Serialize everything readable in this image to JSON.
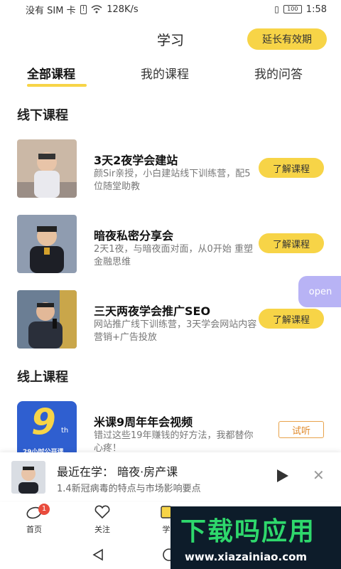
{
  "status_bar": {
    "carrier": "没有 SIM 卡",
    "speed": "128K/s",
    "battery": "100",
    "time": "1:58"
  },
  "header": {
    "title": "学习",
    "extend_button": "延长有效期"
  },
  "tabs": [
    "全部课程",
    "我的课程",
    "我的问答"
  ],
  "sections": {
    "offline": "线下课程",
    "online": "线上课程"
  },
  "offline_courses": [
    {
      "title": "3天2夜学会建站",
      "desc": "颜Sir亲授，小白建站线下训练营，配5位随堂助教",
      "button": "了解课程"
    },
    {
      "title": "暗夜私密分享会",
      "desc": "2天1夜，与暗夜面对面，从0开始 重塑金融思维",
      "button": "了解课程"
    },
    {
      "title": "三天两夜学会推广SEO",
      "desc": "网站推广线下训练营，3天学会网站内容营销+广告投放",
      "button": "了解课程"
    }
  ],
  "online_courses": [
    {
      "title": "米课9周年年会视频",
      "desc": "错过这些19年赚钱的好方法，我都替你心疼！",
      "button": "试听",
      "thumb_text": "9",
      "thumb_sup": "th",
      "thumb_caption": "29小时公开课"
    }
  ],
  "open_button": "open",
  "recent": {
    "title": "最近在学：  暗夜·房产课",
    "subtitle": "1.4新冠病毒的特点与市场影响要点"
  },
  "bottom_nav": [
    {
      "label": "首页",
      "badge": "1"
    },
    {
      "label": "关注"
    },
    {
      "label": "学"
    }
  ],
  "watermark": {
    "text": "下载吗应用",
    "url": "www.xiazainiao.com"
  },
  "colors": {
    "accent": "#f7d447",
    "open": "#b8b3f5",
    "badge": "#e94b3c",
    "trial": "#e08a2c"
  }
}
